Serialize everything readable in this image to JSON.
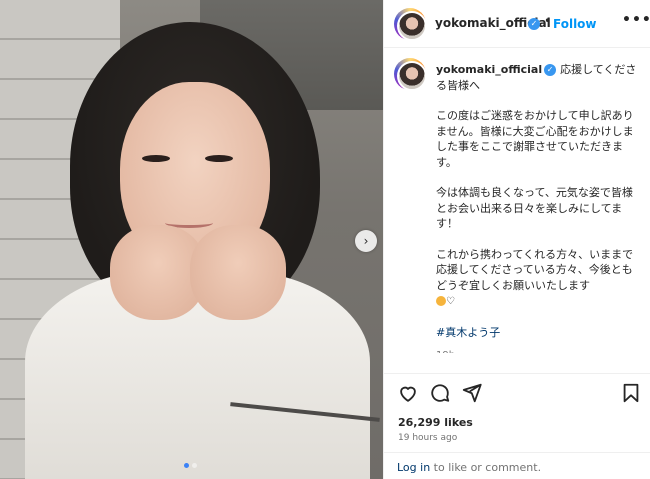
{
  "post": {
    "username": "yokomaki_official",
    "follow_label": "Follow",
    "separator": "•",
    "more_label": "•••",
    "caption_lead": "応援してくださる皆様へ",
    "caption_paragraphs": [
      "この度はご迷惑をおかけして申し訳ありません。皆様に大変ご心配をおかけしました事をここで謝罪させていただきます。",
      "今は体調も良くなって、元気な姿で皆様とお会い出来る日々を楽しみにしてます！",
      "これから携わってくれる方々、いままで応援してくださっている方々、今後ともどうぞ宜しくお願いいたします"
    ],
    "caption_heart": "♡",
    "hashtag": "#真木よう子",
    "time_ago": "19h",
    "likes": "26,299 likes",
    "posted": "19 hours ago",
    "login_link": "Log in",
    "login_suffix": " to like or comment.",
    "load_more": "+"
  },
  "media": {
    "next_arrow": "›",
    "carousel_count": 2,
    "carousel_active": 0
  },
  "colors": {
    "accent": "#0095f6",
    "verified": "#3897f0",
    "hashtag": "#00376b",
    "muted": "#737373"
  },
  "icons": [
    "heart-icon",
    "comment-icon",
    "share-icon",
    "bookmark-icon",
    "verified-badge-icon",
    "chevron-right-icon",
    "more-icon",
    "plus-circle-icon"
  ]
}
